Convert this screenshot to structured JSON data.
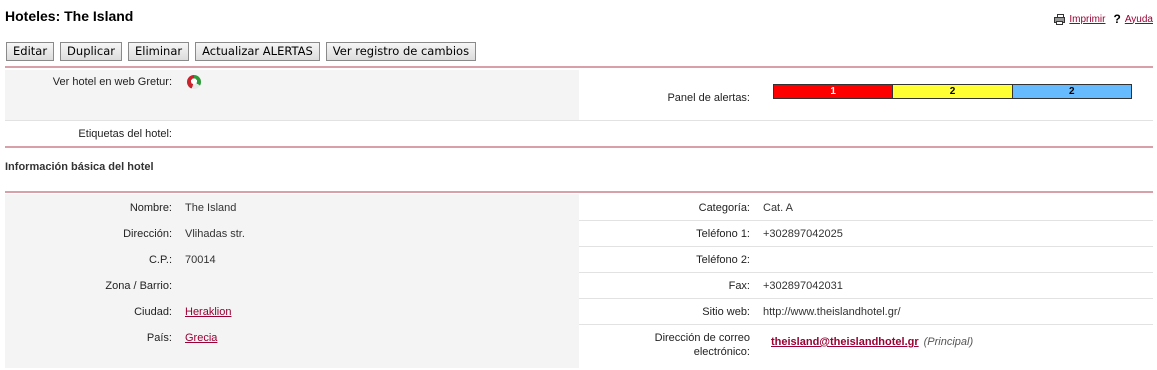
{
  "page": {
    "title": "Hoteles: The Island",
    "print_label": "Imprimir",
    "help_label": "Ayuda"
  },
  "toolbar": {
    "edit": "Editar",
    "duplicate": "Duplicar",
    "delete": "Eliminar",
    "update_alerts": "Actualizar ALERTAS",
    "changelog": "Ver registro de cambios"
  },
  "top": {
    "web_label": "Ver hotel en web Gretur:",
    "alerts_label": "Panel de alertas:",
    "alerts": [
      {
        "value": "1",
        "color": "#ff0000",
        "text_color": "#ffffff"
      },
      {
        "value": "2",
        "color": "#ffff33",
        "text_color": "#000000"
      },
      {
        "value": "2",
        "color": "#66bbff",
        "text_color": "#000000"
      }
    ],
    "tags_label": "Etiquetas del hotel:"
  },
  "section": {
    "title": "Información básica del hotel"
  },
  "fields": {
    "name_label": "Nombre:",
    "name": "The Island",
    "category_label": "Categoría:",
    "category": "Cat. A",
    "address_label": "Dirección:",
    "address": "Vlihadas str.",
    "phone1_label": "Teléfono 1:",
    "phone1": "+302897042025",
    "zip_label": "C.P.:",
    "zip": "70014",
    "phone2_label": "Teléfono 2:",
    "phone2": "",
    "zone_label": "Zona / Barrio:",
    "zone": "",
    "fax_label": "Fax:",
    "fax": "+302897042031",
    "city_label": "Ciudad:",
    "city": "Heraklion",
    "website_label": "Sitio web:",
    "website": "http://www.theislandhotel.gr/",
    "country_label": "País:",
    "country": "Grecia",
    "email_label_1": "Dirección de correo",
    "email_label_2": "electrónico:",
    "email": "theisland@theislandhotel.gr",
    "email_note": "(Principal)"
  },
  "colors": {
    "link": "#990033",
    "separator": "#d8a0a8",
    "row_bg": "#f4f4f4"
  }
}
